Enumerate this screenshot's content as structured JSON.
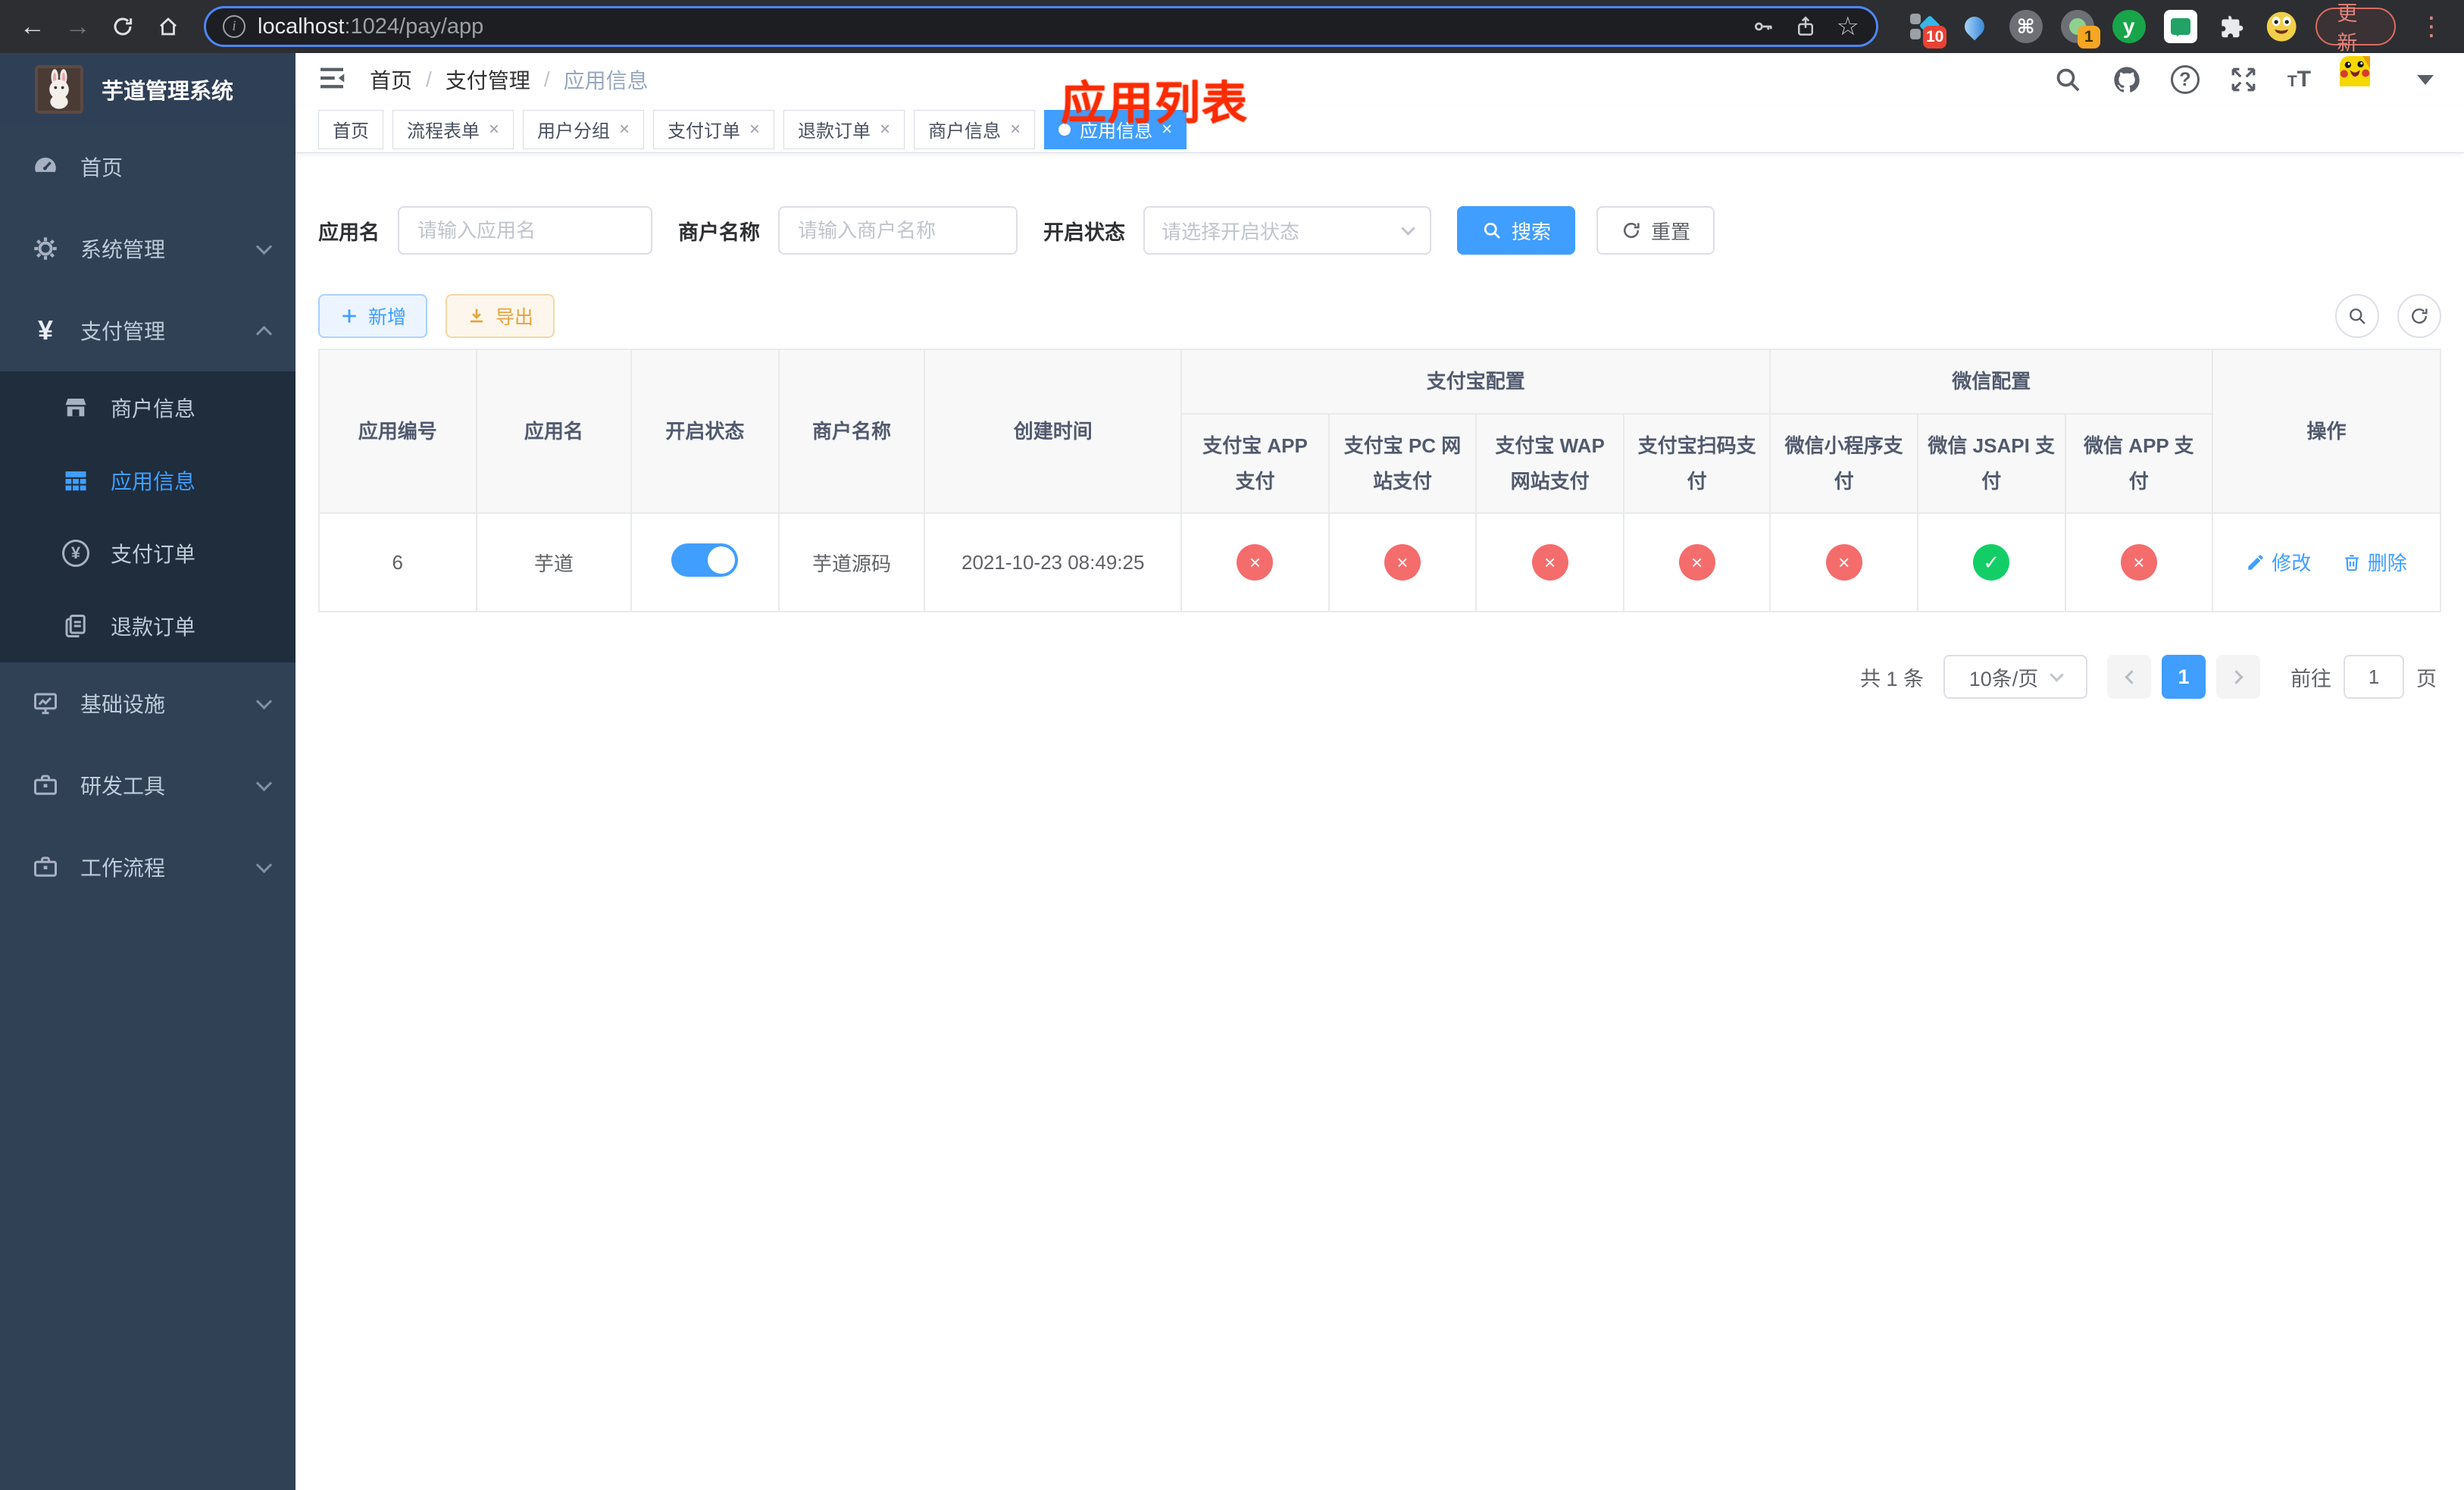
{
  "browser": {
    "url_host": "localhost",
    "url_path": ":1024/pay/app",
    "update_label": "更新",
    "ext_badges": {
      "blocks": "10",
      "proxy": "1"
    },
    "ext_y_label": "y"
  },
  "sidebar": {
    "title": "芋道管理系统",
    "items": [
      {
        "label": "首页",
        "icon": "dashboard-icon"
      },
      {
        "label": "系统管理",
        "icon": "gear-icon"
      },
      {
        "label": "支付管理",
        "icon": "yen-icon"
      },
      {
        "label": "商户信息",
        "icon": "shop-icon"
      },
      {
        "label": "应用信息",
        "icon": "grid-icon"
      },
      {
        "label": "支付订单",
        "icon": "yen-circle-icon"
      },
      {
        "label": "退款订单",
        "icon": "document-icon"
      },
      {
        "label": "基础设施",
        "icon": "monitor-icon"
      },
      {
        "label": "研发工具",
        "icon": "briefcase-icon"
      },
      {
        "label": "工作流程",
        "icon": "briefcase-icon"
      }
    ]
  },
  "topbar": {
    "breadcrumb": [
      "首页",
      "支付管理",
      "应用信息"
    ],
    "annotation": "应用列表",
    "font_size_icon": "T"
  },
  "tabs": [
    {
      "label": "首页"
    },
    {
      "label": "流程表单"
    },
    {
      "label": "用户分组"
    },
    {
      "label": "支付订单"
    },
    {
      "label": "退款订单"
    },
    {
      "label": "商户信息"
    },
    {
      "label": "应用信息"
    }
  ],
  "filters": {
    "app_name_label": "应用名",
    "app_name_placeholder": "请输入应用名",
    "merchant_label": "商户名称",
    "merchant_placeholder": "请输入商户名称",
    "status_label": "开启状态",
    "status_placeholder": "请选择开启状态",
    "search_label": "搜索",
    "reset_label": "重置"
  },
  "toolbar": {
    "add_label": "新增",
    "export_label": "导出"
  },
  "table": {
    "group_alipay": "支付宝配置",
    "group_wechat": "微信配置",
    "col_app_id": "应用编号",
    "col_app_name": "应用名",
    "col_status": "开启状态",
    "col_merchant": "商户名称",
    "col_created": "创建时间",
    "col_alipay_app": "支付宝 APP 支付",
    "col_alipay_pc": "支付宝 PC 网站支付",
    "col_alipay_wap": "支付宝 WAP 网站支付",
    "col_alipay_qr": "支付宝扫码支付",
    "col_wx_mini": "微信小程序支付",
    "col_wx_jsapi": "微信 JSAPI 支付",
    "col_wx_app": "微信 APP 支付",
    "col_actions": "操作",
    "row": {
      "app_id": "6",
      "app_name": "芋道",
      "enabled": true,
      "merchant": "芋道源码",
      "created": "2021-10-23 08:49:25",
      "statuses": [
        false,
        false,
        false,
        false,
        false,
        true,
        false
      ],
      "edit_label": "修改",
      "delete_label": "删除"
    }
  },
  "pagination": {
    "total": "共 1 条",
    "page_size": "10条/页",
    "page": "1",
    "goto_label": "前往",
    "goto_value": "1",
    "page_unit": "页"
  },
  "colors": {
    "primary": "#409eff",
    "success": "#13ce66",
    "danger": "#f56c6c",
    "warning": "#e6a23c",
    "sidebar_bg": "#304156",
    "submenu_bg": "#1f2d3d",
    "annotation_red": "#fb2b00"
  }
}
